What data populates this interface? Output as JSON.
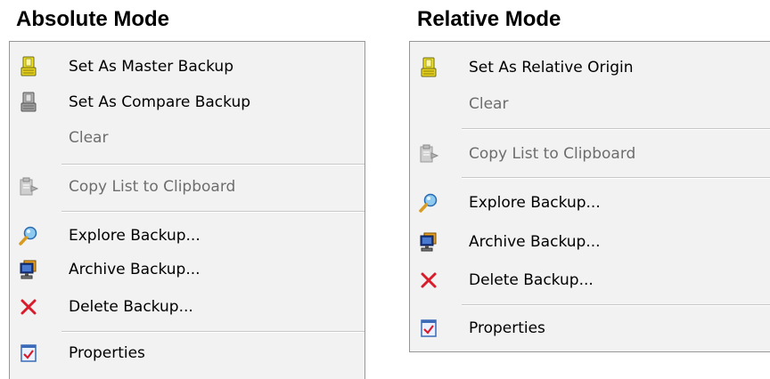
{
  "headings": {
    "absolute": "Absolute Mode",
    "relative": "Relative Mode"
  },
  "absolute_menu": {
    "items": [
      {
        "label": "Set As Master Backup",
        "icon": "lock-yellow-icon",
        "enabled": true
      },
      {
        "label": "Set As Compare Backup",
        "icon": "lock-gray-icon",
        "enabled": true
      },
      {
        "label": "Clear",
        "icon": null,
        "enabled": false
      },
      {
        "label": "Copy List to Clipboard",
        "icon": "clipboard-icon",
        "enabled": false
      },
      {
        "label": "Explore Backup...",
        "icon": "magnifier-icon",
        "enabled": true
      },
      {
        "label": "Archive Backup...",
        "icon": "archive-icon",
        "enabled": true
      },
      {
        "label": "Delete Backup...",
        "icon": "delete-x-icon",
        "enabled": true
      },
      {
        "label": "Properties",
        "icon": "properties-icon",
        "enabled": true
      }
    ]
  },
  "relative_menu": {
    "items": [
      {
        "label": "Set As Relative Origin",
        "icon": "lock-yellow-icon",
        "enabled": true
      },
      {
        "label": "Clear",
        "icon": null,
        "enabled": false
      },
      {
        "label": "Copy List to Clipboard",
        "icon": "clipboard-icon",
        "enabled": false
      },
      {
        "label": "Explore Backup...",
        "icon": "magnifier-icon",
        "enabled": true
      },
      {
        "label": "Archive Backup...",
        "icon": "archive-icon",
        "enabled": true
      },
      {
        "label": "Delete Backup...",
        "icon": "delete-x-icon",
        "enabled": true
      },
      {
        "label": "Properties",
        "icon": "properties-icon",
        "enabled": true
      }
    ]
  },
  "colors": {
    "menu_background": "#f2f2f2",
    "disabled_text": "#6d6d6d",
    "delete_red": "#d81c2c",
    "lock_yellow": "#f3e21a"
  }
}
